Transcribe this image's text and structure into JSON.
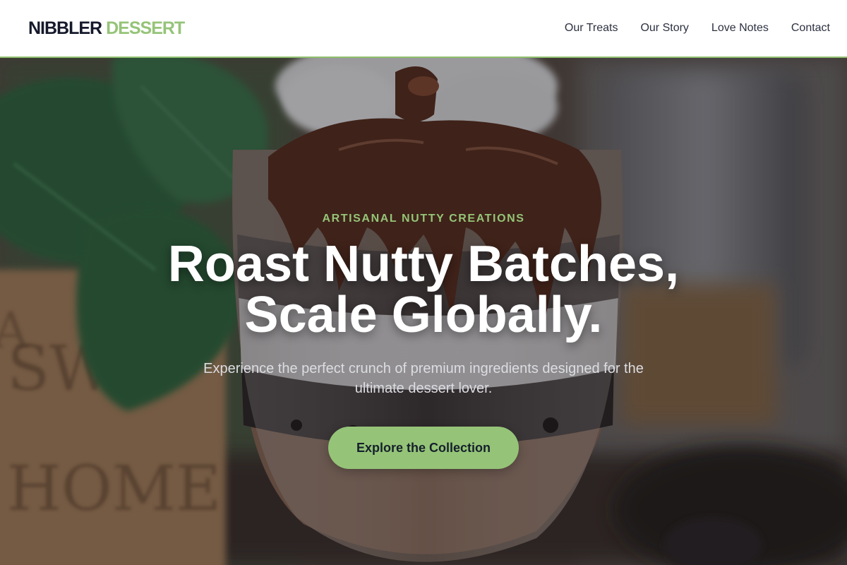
{
  "header": {
    "logo": {
      "primary": "NIBBLER",
      "accent": "DESSERT"
    },
    "nav": [
      {
        "label": "Our Treats"
      },
      {
        "label": "Our Story"
      },
      {
        "label": "Love Notes"
      },
      {
        "label": "Contact"
      }
    ]
  },
  "hero": {
    "kicker": "ARTISANAL NUTTY CREATIONS",
    "title_lines": [
      "Roast Nutty Batches,",
      "Scale Globally."
    ],
    "subtitle_lines": [
      "Experience the perfect crunch of premium ingredients designed for the",
      "ultimate dessert lover."
    ],
    "cta_label": "Explore the Collection",
    "background_image": "chocolate-sundae-parfait-photo"
  },
  "colors": {
    "accent": "#95c478",
    "logo_dark": "#15192b",
    "nav_text": "#2c3140",
    "header_border": "#8fbf6e"
  }
}
